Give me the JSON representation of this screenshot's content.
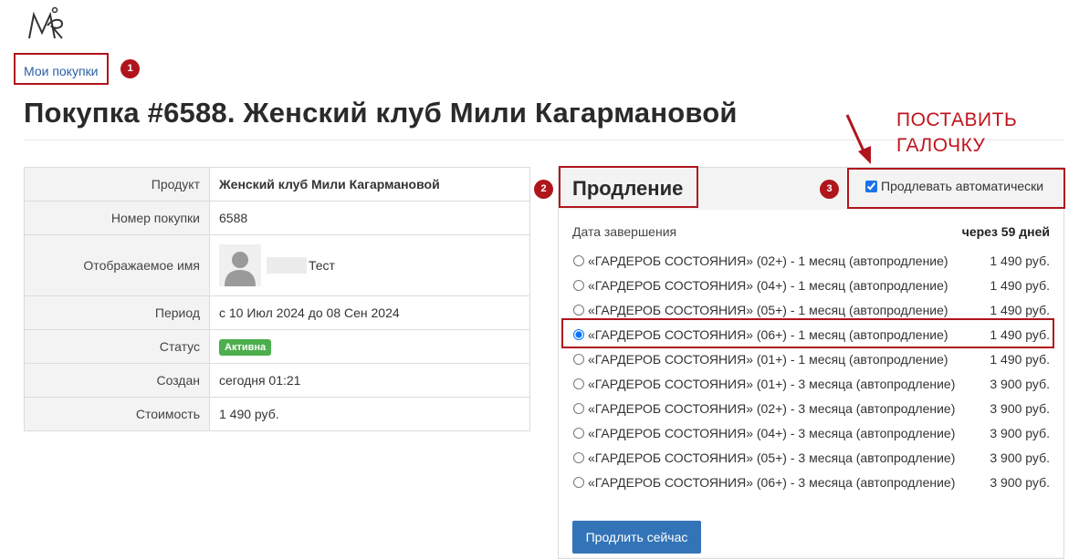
{
  "breadcrumb": {
    "label": "Мои покупки"
  },
  "annotations": {
    "badge_1": "1",
    "badge_2": "2",
    "badge_3": "3",
    "instruction_line1": "ПОСТАВИТЬ",
    "instruction_line2": "ГАЛОЧКУ",
    "highlight_color": "#b0151c"
  },
  "page": {
    "title": "Покупка #6588. Женский клуб Мили Кагармановой"
  },
  "details": {
    "product_label": "Продукт",
    "product_value": "Женский клуб Мили Кагармановой",
    "number_label": "Номер покупки",
    "number_value": "6588",
    "display_name_label": "Отображаемое имя",
    "display_name_value": "Тест",
    "period_label": "Период",
    "period_value": "с 10 Июл 2024 до 08 Сен 2024",
    "status_label": "Статус",
    "status_value": "Активна",
    "status_color": "#4cae4c",
    "created_label": "Создан",
    "created_value": "сегодня 01:21",
    "cost_label": "Стоимость",
    "cost_value": "1 490 руб."
  },
  "renewal": {
    "title": "Продление",
    "auto_label": "Продлевать автоматически",
    "auto_checked": true,
    "end_label": "Дата завершения",
    "end_value": "через 59 дней",
    "options": [
      {
        "label": "«ГАРДЕРОБ СОСТОЯНИЯ» (02+) - 1 месяц (автопродление)",
        "price": "1 490 руб."
      },
      {
        "label": "«ГАРДЕРОБ СОСТОЯНИЯ» (04+) - 1 месяц (автопродление)",
        "price": "1 490 руб."
      },
      {
        "label": "«ГАРДЕРОБ СОСТОЯНИЯ» (05+) - 1 месяц (автопродление)",
        "price": "1 490 руб."
      },
      {
        "label": "«ГАРДЕРОБ СОСТОЯНИЯ» (06+) - 1 месяц (автопродление)",
        "price": "1 490 руб."
      },
      {
        "label": "«ГАРДЕРОБ СОСТОЯНИЯ» (01+) - 1 месяц (автопродление)",
        "price": "1 490 руб."
      },
      {
        "label": "«ГАРДЕРОБ СОСТОЯНИЯ» (01+) - 3 месяца (автопродление)",
        "price": "3 900 руб."
      },
      {
        "label": "«ГАРДЕРОБ СОСТОЯНИЯ» (02+) - 3 месяца (автопродление)",
        "price": "3 900 руб."
      },
      {
        "label": "«ГАРДЕРОБ СОСТОЯНИЯ» (04+) - 3 месяца (автопродление)",
        "price": "3 900 руб."
      },
      {
        "label": "«ГАРДЕРОБ СОСТОЯНИЯ» (05+) - 3 месяца (автопродление)",
        "price": "3 900 руб."
      },
      {
        "label": "«ГАРДЕРОБ СОСТОЯНИЯ» (06+) - 3 месяца (автопродление)",
        "price": "3 900 руб."
      }
    ],
    "selected_index": 3,
    "renew_button": "Продлить сейчас",
    "button_color": "#3373b7"
  }
}
